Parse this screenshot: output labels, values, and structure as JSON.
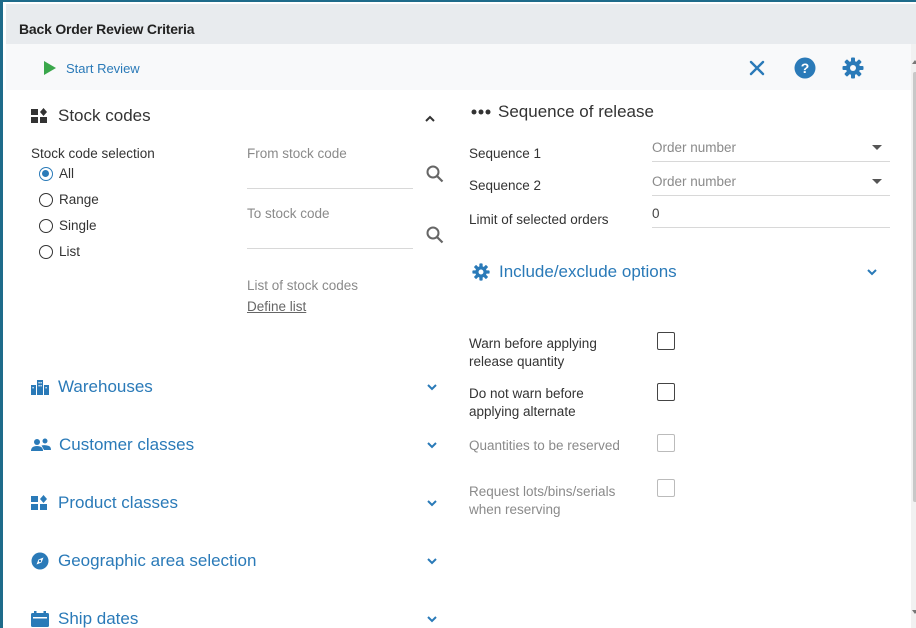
{
  "window": {
    "title": "Back Order Review Criteria"
  },
  "toolbar": {
    "start_label": "Start Review",
    "close_icon": "close-icon",
    "help_icon": "help-icon",
    "settings_icon": "gear-icon"
  },
  "colors": {
    "accent": "#2a7ab8",
    "play": "#3aa74b",
    "frame": "#1e6b8a"
  },
  "stock_codes": {
    "title": "Stock codes",
    "selection_label": "Stock code selection",
    "options": [
      "All",
      "Range",
      "Single",
      "List"
    ],
    "selected": "All",
    "from_label": "From stock code",
    "to_label": "To stock code",
    "list_label": "List of stock codes",
    "define_list": "Define list"
  },
  "sections": {
    "warehouses": "Warehouses",
    "customer_classes": "Customer classes",
    "product_classes": "Product classes",
    "geographic": "Geographic area selection",
    "ship_dates": "Ship dates"
  },
  "sequence": {
    "title": "Sequence of release",
    "seq1_label": "Sequence 1",
    "seq1_value": "Order number",
    "seq2_label": "Sequence 2",
    "seq2_value": "Order number",
    "limit_label": "Limit of selected orders",
    "limit_value": "0"
  },
  "include_exclude": {
    "title": "Include/exclude options",
    "warn_release_1": "Warn before applying",
    "warn_release_2": "release quantity",
    "no_warn_alt_1": "Do not warn before",
    "no_warn_alt_2": "applying alternate",
    "quantities_reserved": "Quantities to be reserved",
    "request_lots_1": "Request lots/bins/serials",
    "request_lots_2": "when reserving"
  }
}
